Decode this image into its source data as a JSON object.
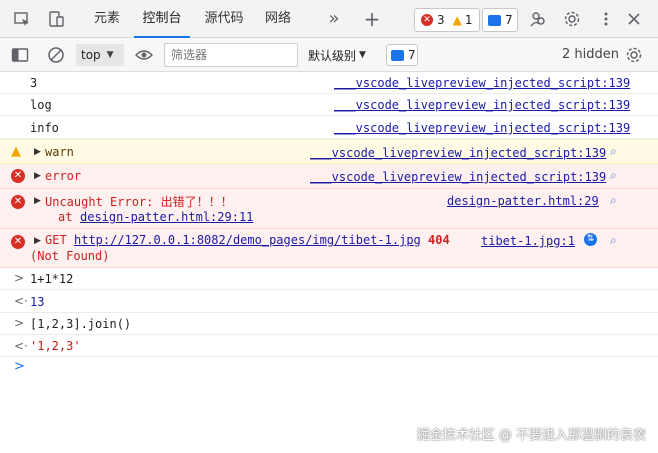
{
  "tabs": [
    {
      "label": "元素",
      "active": false
    },
    {
      "label": "控制台",
      "active": true
    },
    {
      "label": "源代码",
      "active": false
    },
    {
      "label": "网络",
      "active": false
    }
  ],
  "tabbar": {
    "more": "»",
    "add": "+",
    "error_count": "3",
    "warn_count": "1",
    "msg_count": "7"
  },
  "toolbar": {
    "context": "top",
    "filter_placeholder": "筛选器",
    "level": "默认级别",
    "msg_count": "7",
    "hidden": "2 hidden"
  },
  "messages": {
    "m0": {
      "text": "3",
      "src": "___vscode_livepreview_injected_script:139"
    },
    "m1": {
      "text": "log",
      "src": "___vscode_livepreview_injected_script:139"
    },
    "m2": {
      "text": "info",
      "src": "___vscode_livepreview_injected_script:139"
    },
    "m3": {
      "text": "warn",
      "src": "___vscode_livepreview_injected_script:139"
    },
    "m4": {
      "text": "error",
      "src": "___vscode_livepreview_injected_script:139"
    },
    "m5": {
      "text": "Uncaught Error: 出错了！！！",
      "at": "at",
      "link": "design-patter.html:29:11",
      "src": "design-patter.html:29"
    },
    "m6": {
      "method": "GET",
      "url": "http://127.0.0.1:8082/demo_pages/img/tibet-1.jpg",
      "code": "404",
      "status": "(Not Found)",
      "src": "tibet-1.jpg:1"
    }
  },
  "repl": [
    {
      "kind": "input",
      "text": "1+1*12"
    },
    {
      "kind": "output",
      "text": "13"
    },
    {
      "kind": "input",
      "text": "[1,2,3].join()"
    },
    {
      "kind": "output",
      "text": "'1,2,3'"
    }
  ],
  "watermark": "掘金技术社区 @ 不要进入那温驯的良夜",
  "colors": {
    "accent": "#1a73e8",
    "error": "#d93025",
    "warn": "#f2a600"
  }
}
